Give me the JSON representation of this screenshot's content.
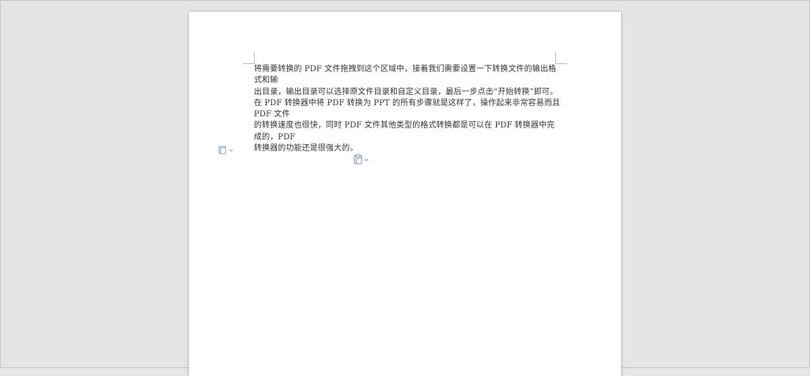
{
  "document": {
    "lines": [
      "将需要转换的 PDF 文件拖拽到这个区域中，接着我们需要设置一下转换文件的输出格式和输",
      "出目录，输出目录可以选择原文件目录和自定义目录，最后一步点击“开始转换”即可。",
      "在 PDF 转换器中将 PDF 转换为 PPT 的所有步骤就是这样了，操作起来非常容易而且 PDF 文件",
      "的转换速度也很快，同时 PDF 文件其他类型的格式转换都是可以在 PDF 转换器中完成的，PDF",
      "转换器的功能还是很强大的。"
    ]
  },
  "icons": {
    "paste_left": "paste-options-icon",
    "paste_mid": "paste-options-icon"
  }
}
